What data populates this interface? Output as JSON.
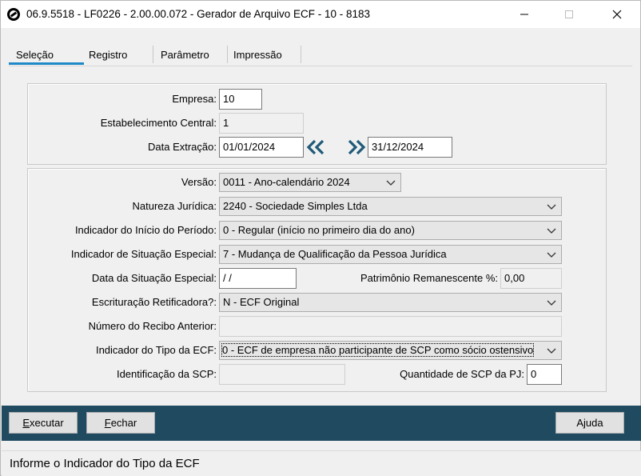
{
  "window": {
    "title": "06.9.5518 - LF0226 - 2.00.00.072 - Gerador de Arquivo ECF - 10 - 8183"
  },
  "tabs": [
    {
      "label": "Seleção",
      "active": true
    },
    {
      "label": "Registro",
      "active": false
    },
    {
      "label": "Parâmetro",
      "active": false
    },
    {
      "label": "Impressão",
      "active": false
    }
  ],
  "form": {
    "empresa": {
      "label": "Empresa:",
      "value": "10"
    },
    "estabelecimento": {
      "label": "Estabelecimento Central:",
      "value": "1"
    },
    "data_extracao": {
      "label": "Data Extração:",
      "start": "01/01/2024",
      "end": "31/12/2024"
    },
    "versao": {
      "label": "Versão:",
      "value": "0011 - Ano-calendário 2024"
    },
    "natureza_juridica": {
      "label": "Natureza Jurídica:",
      "value": "2240 - Sociedade Simples Ltda"
    },
    "indicador_inicio": {
      "label": "Indicador do Início do Período:",
      "value": "0 - Regular (início no primeiro dia do ano)"
    },
    "indicador_situacao": {
      "label": "Indicador de Situação Especial:",
      "value": "7 - Mudança de Qualificação da Pessoa Jurídica"
    },
    "data_situacao": {
      "label": "Data da Situação Especial:",
      "value": " / /"
    },
    "patrimonio": {
      "label": "Patrimônio Remanescente %:",
      "value": "0,00"
    },
    "escrituracao": {
      "label": "Escrituração Retificadora?:",
      "value": "N - ECF Original"
    },
    "recibo_anterior": {
      "label": "Número do Recibo Anterior:",
      "value": ""
    },
    "indicador_tipo": {
      "label": "Indicador do Tipo da ECF:",
      "value": "0 - ECF de empresa não participante de SCP como sócio ostensivo"
    },
    "identificacao_scp": {
      "label": "Identificação da SCP:",
      "value": ""
    },
    "quantidade_scp": {
      "label": "Quantidade de SCP da PJ:",
      "value": "0"
    }
  },
  "buttons": {
    "executar": {
      "label_underlined": "E",
      "label_rest": "xecutar"
    },
    "fechar": {
      "label_underlined": "F",
      "label_rest": "echar"
    },
    "ajuda": {
      "label": "Ajuda"
    }
  },
  "status": {
    "text": "Informe o Indicador do Tipo da ECF"
  },
  "colors": {
    "accent": "#1e88c8",
    "bottom_bar": "#1f4a5f",
    "arrows": "#1f5a78"
  }
}
